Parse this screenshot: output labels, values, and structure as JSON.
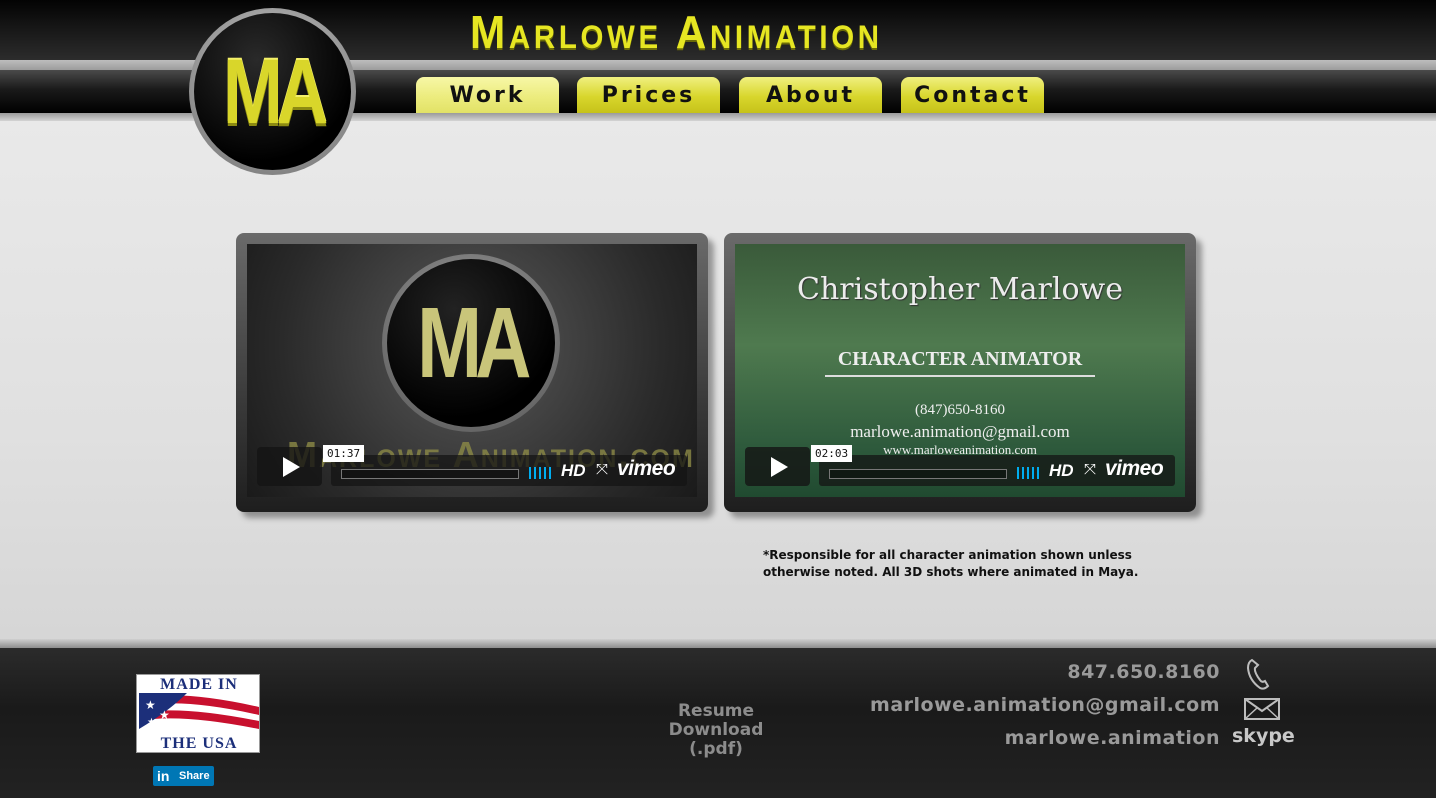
{
  "site": {
    "title": "Marlowe Animation",
    "logo_text": "MA"
  },
  "nav": {
    "items": [
      {
        "label": "Work",
        "active": true
      },
      {
        "label": "Prices"
      },
      {
        "label": "About"
      },
      {
        "label": "Contact"
      }
    ]
  },
  "videos": [
    {
      "duration": "01:37",
      "logo_text": "MA",
      "overlay_url_text": "Marlowe Animation.com",
      "hd_label": "HD",
      "brand": "vimeo"
    },
    {
      "duration": "02:03",
      "card_name": "Christopher Marlowe",
      "card_role": "CHARACTER ANIMATOR",
      "card_phone": "(847)650-8160",
      "card_email": "marlowe.animation@gmail.com",
      "card_site": "www.marloweanimation.com",
      "hd_label": "HD",
      "brand": "vimeo"
    }
  ],
  "note": "*Responsible for all character animation shown unless otherwise noted.  All 3D shots where animated in Maya.",
  "footer": {
    "badge": {
      "line1": "MADE IN",
      "line2": "THE USA"
    },
    "linkedin": {
      "icon_text": "in",
      "label": "Share"
    },
    "resume": {
      "line1": "Resume",
      "line2": "Download",
      "line3": "(.pdf)"
    },
    "phone": "847.650.8160",
    "email": "marlowe.animation@gmail.com",
    "skype": "marlowe.animation",
    "skype_icon_text": "skype"
  },
  "colors": {
    "accent_yellow": "#d8d62c",
    "vimeo_blue": "#00adef",
    "linkedin_blue": "#0077b5"
  }
}
